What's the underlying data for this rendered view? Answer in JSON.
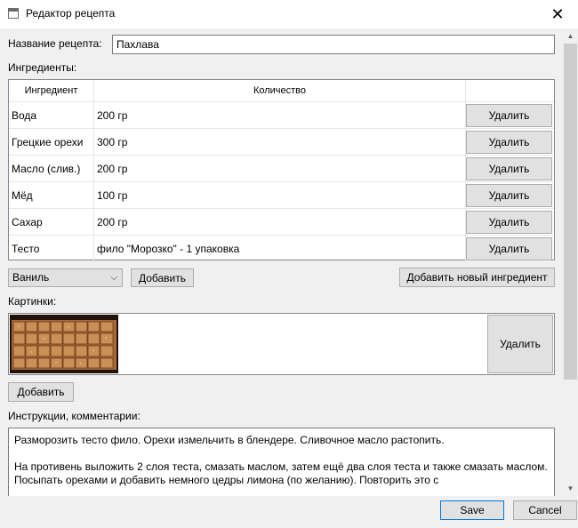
{
  "window": {
    "title": "Редактор рецепта",
    "close_glyph": "✕"
  },
  "recipe_name": {
    "label": "Название рецепта:",
    "value": "Пахлава"
  },
  "ingredients": {
    "label": "Ингредиенты:",
    "columns": [
      "Ингредиент",
      "Количество",
      ""
    ],
    "rows": [
      {
        "name": "Вода",
        "amount": "200 гр",
        "delete": "Удалить"
      },
      {
        "name": "Грецкие орехи",
        "amount": "300 гр",
        "delete": "Удалить"
      },
      {
        "name": "Масло (слив.)",
        "amount": "200 гр",
        "delete": "Удалить"
      },
      {
        "name": "Мёд",
        "amount": "100 гр",
        "delete": "Удалить"
      },
      {
        "name": "Сахар",
        "amount": "200 гр",
        "delete": "Удалить"
      },
      {
        "name": "Тесто",
        "amount": "фило \"Морозко\" - 1 упаковка",
        "delete": "Удалить"
      }
    ],
    "select_value": "Ваниль",
    "add_label": "Добавить",
    "add_new_label": "Добавить новый ингредиент"
  },
  "images": {
    "label": "Картинки:",
    "delete_label": "Удалить",
    "add_label": "Добавить"
  },
  "instructions": {
    "label": "Инструкции, комментарии:",
    "paragraph1": "Разморозить тесто фило. Орехи измельчить в блендере. Сливочное масло растопить.",
    "paragraph2": "На противень выложить 2 слоя теста, смазать маслом, затем ещё два слоя теста и также смазать маслом. Посыпать орехами и добавить немного цедры лимона (по желанию). Повторить это с"
  },
  "footer": {
    "save_label": "Save",
    "cancel_label": "Cancel"
  },
  "colors": {
    "window_bg": "#f0f0f0",
    "button_bg": "#e1e1e1",
    "save_border": "#0078d7"
  }
}
